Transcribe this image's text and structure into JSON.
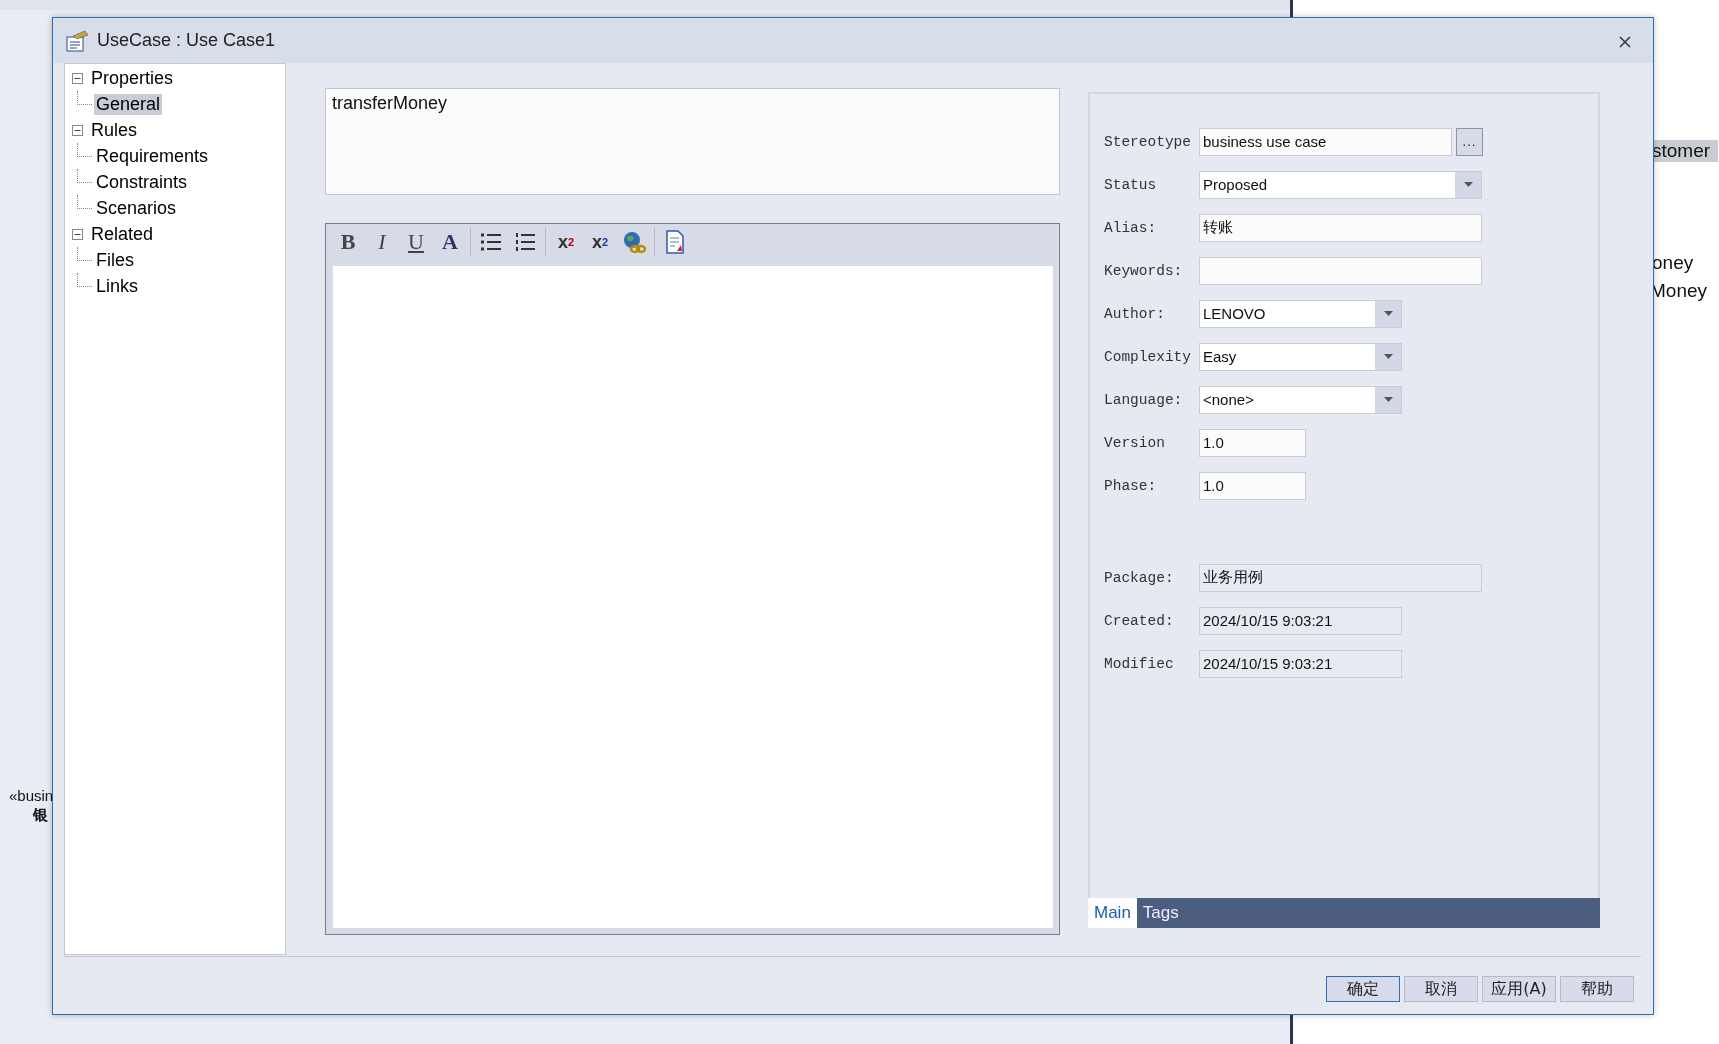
{
  "background": {
    "texts": [
      {
        "kind": "highlight",
        "text": "stomer"
      },
      {
        "kind": "plain",
        "text": "oney"
      },
      {
        "kind": "plain",
        "text": "Money"
      },
      {
        "kind": "stereotype",
        "text": "«busin"
      },
      {
        "kind": "bold",
        "text": "银"
      }
    ]
  },
  "window": {
    "title": "UseCase : Use Case1"
  },
  "tree": [
    {
      "label": "Properties",
      "expanded": true,
      "selected": false,
      "children": [
        {
          "label": "General",
          "selected": true
        }
      ]
    },
    {
      "label": "Rules",
      "expanded": true,
      "selected": false,
      "children": [
        {
          "label": "Requirements",
          "selected": false
        },
        {
          "label": "Constraints",
          "selected": false
        },
        {
          "label": "Scenarios",
          "selected": false
        }
      ]
    },
    {
      "label": "Related",
      "expanded": true,
      "selected": false,
      "children": [
        {
          "label": "Files",
          "selected": false
        },
        {
          "label": "Links",
          "selected": false
        }
      ]
    }
  ],
  "name": {
    "value": "transferMoney"
  },
  "toolbar": [
    {
      "kind": "bold",
      "label": "B"
    },
    {
      "kind": "italic",
      "label": "I"
    },
    {
      "kind": "underline",
      "label": "U"
    },
    {
      "kind": "font-color",
      "label": "A"
    },
    {
      "kind": "separator"
    },
    {
      "kind": "bullets"
    },
    {
      "kind": "numbering"
    },
    {
      "kind": "separator"
    },
    {
      "kind": "superscript",
      "label": "x",
      "mark": "2"
    },
    {
      "kind": "subscript",
      "label": "x",
      "mark": "2"
    },
    {
      "kind": "link"
    },
    {
      "kind": "separator"
    },
    {
      "kind": "document"
    }
  ],
  "fields": [
    {
      "label": "Stereotype",
      "kind": "text",
      "value": "business use case",
      "button": "..."
    },
    {
      "label": "Status",
      "kind": "combo",
      "value": "Proposed"
    },
    {
      "label": "Alias:",
      "kind": "text",
      "value": "转账"
    },
    {
      "label": "Keywords:",
      "kind": "text"
    },
    {
      "label": "Author:",
      "kind": "combo",
      "value": "LENOVO"
    },
    {
      "label": "Complexity",
      "kind": "combo",
      "value": "Easy"
    },
    {
      "label": "Language:",
      "kind": "combo",
      "value": "<none>"
    },
    {
      "label": "Version",
      "kind": "text",
      "value": "1.0"
    },
    {
      "label": "Phase:",
      "kind": "text",
      "value": "1.0"
    },
    {
      "label": "Package:",
      "kind": "readonly",
      "value": "业务用例"
    },
    {
      "label": "Created:",
      "kind": "readonly",
      "value": "2024/10/15 9:03:21"
    },
    {
      "label": "Modifiec",
      "kind": "readonly",
      "value": "2024/10/15 9:03:21"
    }
  ],
  "tabs": [
    {
      "label": "Main",
      "selected": true
    },
    {
      "label": "Tags",
      "selected": false
    }
  ],
  "buttons": [
    {
      "label": "确定",
      "default": true
    },
    {
      "label": "取消",
      "default": false
    },
    {
      "label": "应用(A)",
      "default": false
    },
    {
      "label": "帮助",
      "default": false
    }
  ]
}
